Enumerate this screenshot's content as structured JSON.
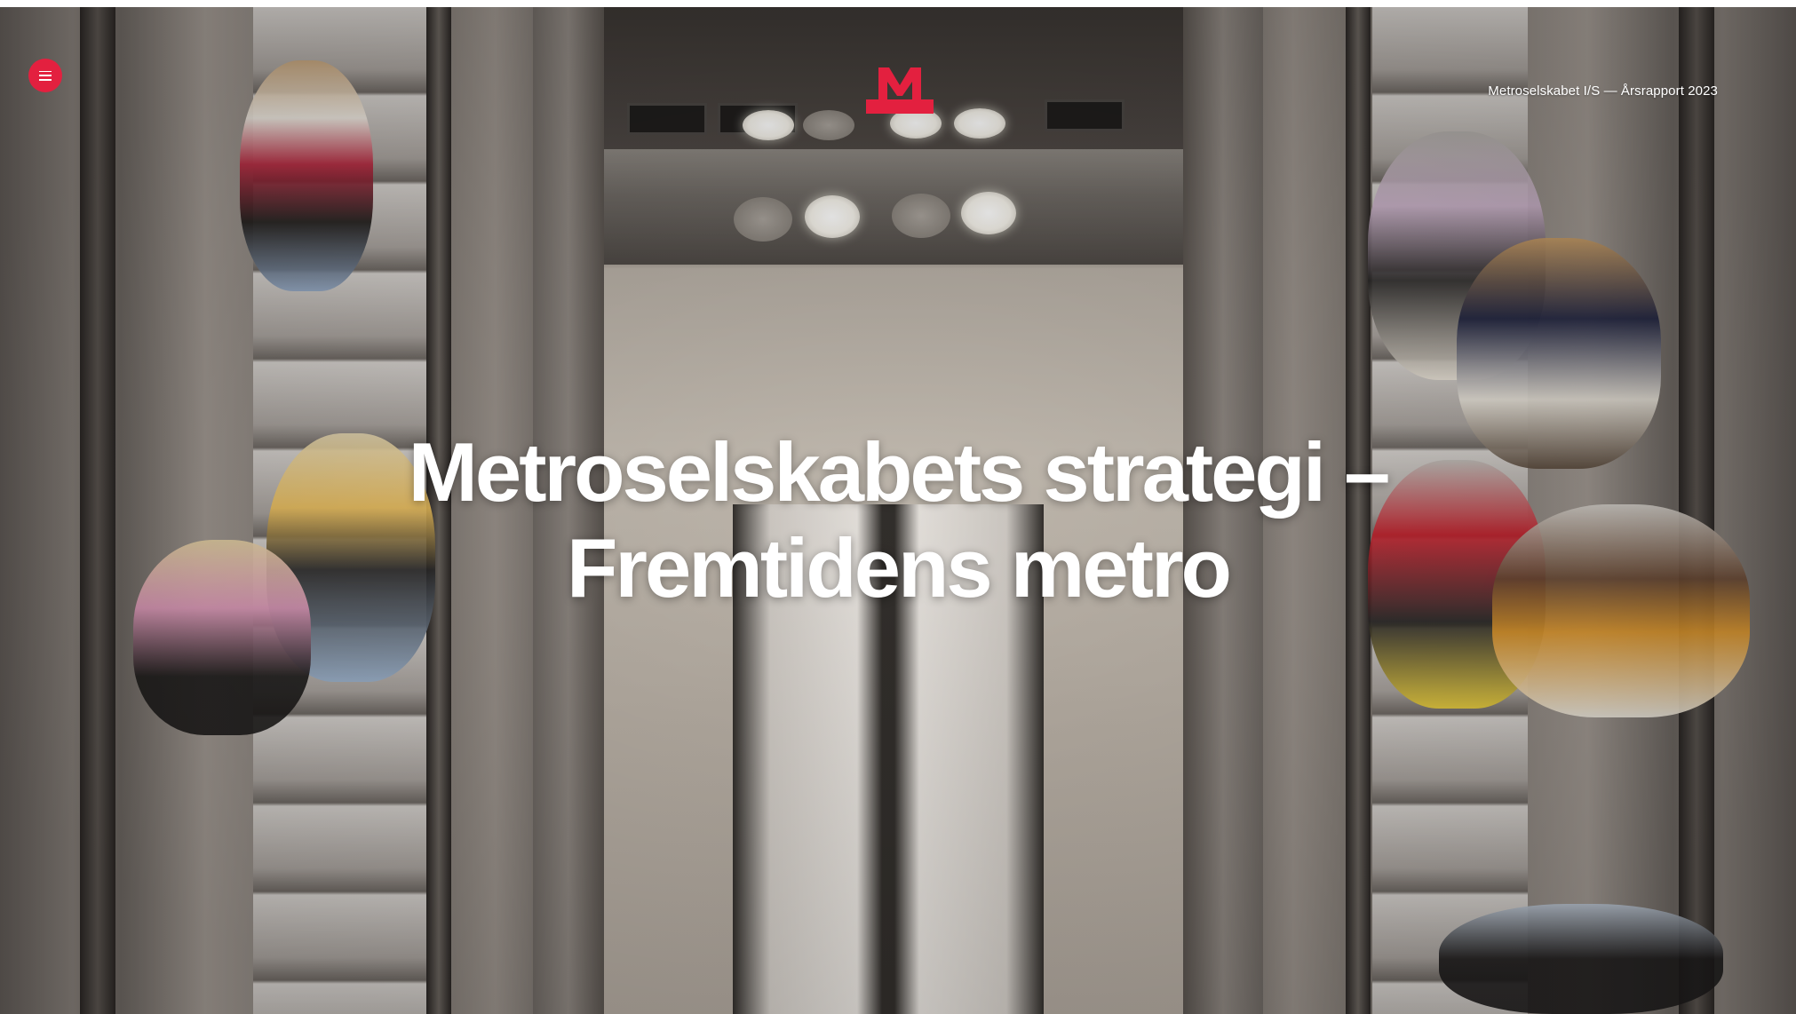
{
  "header": {
    "menu_icon": "hamburger-icon",
    "logo_letter": "M",
    "meta_text": "Metroselskabet I/S — Årsrapport 2023"
  },
  "hero": {
    "title_line1": "Metroselskabets strategi –",
    "title_line2": "Fremtidens metro"
  },
  "colors": {
    "accent": "#e3203f",
    "headline_text": "#ffffff"
  }
}
